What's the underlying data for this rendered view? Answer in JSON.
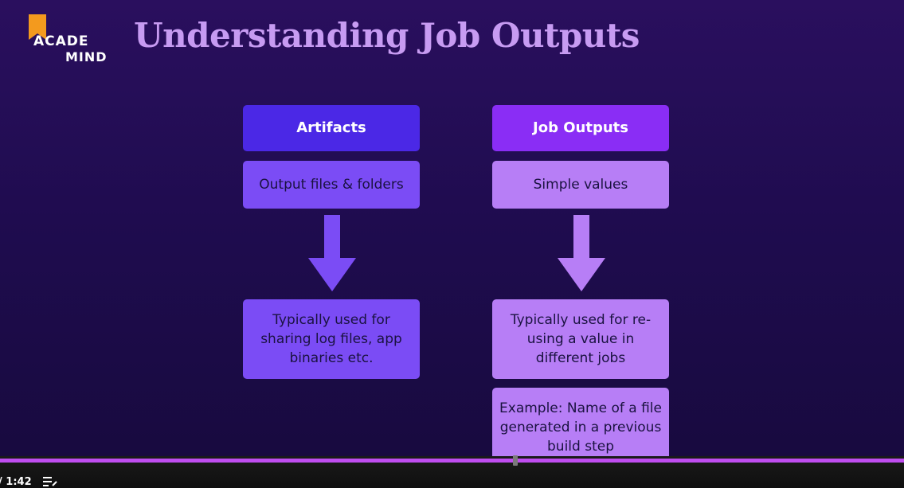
{
  "slide": {
    "logo": {
      "line1": "ACADE",
      "line2": "MIND"
    },
    "title": "Understanding Job Outputs",
    "columns": [
      {
        "header": "Artifacts",
        "subtitle": "Output files & folders",
        "description": "Typically used for sharing log files, app binaries etc."
      },
      {
        "header": "Job Outputs",
        "subtitle": "Simple values",
        "description": "Typically used for re-using a value in different jobs",
        "example": "Example: Name of a file generated in a previous build step"
      }
    ]
  },
  "player": {
    "time": "/ 1:42",
    "progress": 0.57
  },
  "colors": {
    "title": "#c79bf2",
    "artifacts_header": "#4b28e6",
    "artifacts_box": "#7b4cf5",
    "outputs_header": "#8a2df5",
    "outputs_box": "#b77ef6",
    "text_dark": "#1a1240",
    "progress": "#c04df0"
  },
  "icons": {
    "logo": "bookmark-icon",
    "chapters": "chapters-icon"
  }
}
